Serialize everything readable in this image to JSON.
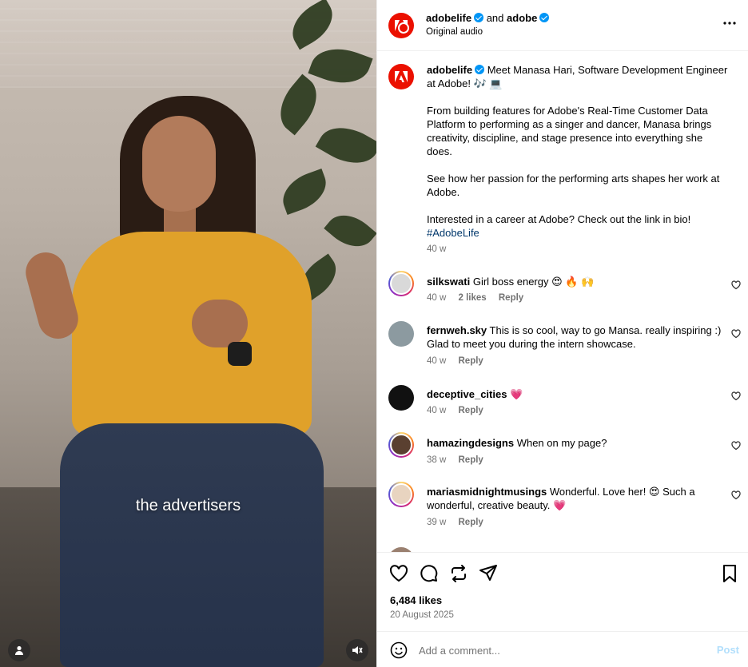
{
  "video": {
    "caption": "the advertisers",
    "user_icon": "person-icon",
    "mute_icon": "speaker-muted-icon"
  },
  "header": {
    "author": "adobelife",
    "connector": "and",
    "collaborator": "adobe",
    "audio": "Original audio",
    "more_icon": "more-horizontal-icon"
  },
  "post": {
    "author": "adobelife",
    "intro": "Meet Manasa Hari, Software Development Engineer at Adobe! 🎶 💻",
    "para1": "From building features for Adobe's Real-Time Customer Data Platform to performing as a singer and dancer, Manasa brings creativity, discipline, and stage presence into everything she does.",
    "para2": "See how her passion for the performing arts shapes her work at Adobe.",
    "para3": "Interested in a career at Adobe? Check out the link in bio!",
    "hashtag": "#AdobeLife",
    "age": "40 w"
  },
  "comments": [
    {
      "user": "silkswati",
      "text": "Girl boss energy 😍 🔥 🙌",
      "age": "40 w",
      "likes": "2 likes",
      "reply": "Reply"
    },
    {
      "user": "fernweh.sky",
      "text": "This is so cool, way to go Mansa. really inspiring :) Glad to meet you during the intern showcase.",
      "age": "40 w",
      "likes": "",
      "reply": "Reply"
    },
    {
      "user": "deceptive_cities",
      "text": "💗",
      "age": "40 w",
      "likes": "",
      "reply": "Reply"
    },
    {
      "user": "hamazingdesigns",
      "text": "When on my page?",
      "age": "38 w",
      "likes": "",
      "reply": "Reply"
    },
    {
      "user": "mariasmidnightmusings",
      "text": "Wonderful. Love her! 😍 Such a wonderful, creative beauty. 💗",
      "age": "39 w",
      "likes": "",
      "reply": "Reply"
    }
  ],
  "actions": {
    "likes": "6,484 likes",
    "date": "20 August 2025",
    "like_icon": "heart-icon",
    "comment_icon": "comment-icon",
    "repost_icon": "repost-icon",
    "share_icon": "send-icon",
    "save_icon": "bookmark-icon"
  },
  "composer": {
    "placeholder": "Add a comment...",
    "post_label": "Post",
    "emoji_icon": "smiley-icon"
  },
  "colors": {
    "adobe_red": "#eb1000",
    "verified_blue": "#0095f6",
    "link": "#00376b",
    "post_disabled": "#b2dffc"
  }
}
